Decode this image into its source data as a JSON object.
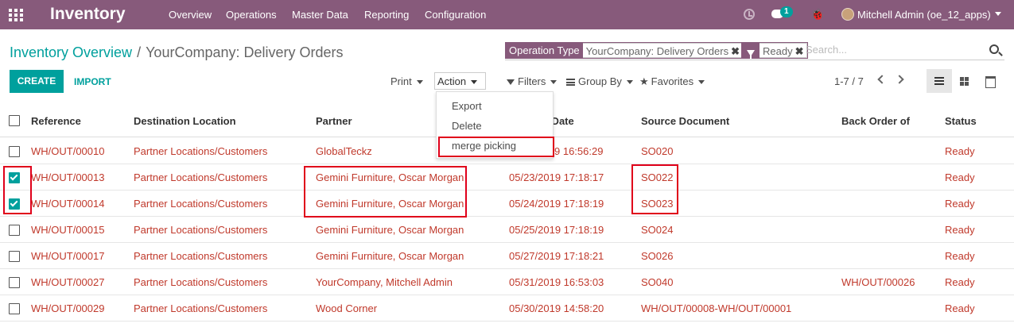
{
  "navbar": {
    "app_title": "Inventory",
    "menu": [
      "Overview",
      "Operations",
      "Master Data",
      "Reporting",
      "Configuration"
    ],
    "chat_count": "1",
    "user_name": "Mitchell Admin (oe_12_apps)"
  },
  "breadcrumb": {
    "parent": "Inventory Overview",
    "separator": "/",
    "current": "YourCompany: Delivery Orders"
  },
  "search": {
    "facets": [
      {
        "label": "Operation Type",
        "value": "YourCompany: Delivery Orders"
      },
      {
        "label": "",
        "value": "Ready"
      }
    ],
    "placeholder": "Search..."
  },
  "buttons": {
    "create": "CREATE",
    "import": "IMPORT",
    "print": "Print",
    "action": "Action",
    "filters": "Filters",
    "group_by": "Group By",
    "favorites": "Favorites"
  },
  "pager": "1-7 / 7",
  "action_menu": [
    "Export",
    "Delete",
    "merge picking"
  ],
  "table": {
    "headers": [
      "Reference",
      "Destination Location",
      "Partner",
      "d Date",
      "Source Document",
      "Back Order of",
      "Status"
    ],
    "rows": [
      {
        "checked": false,
        "ref": "WH/OUT/00010",
        "dest": "Partner Locations/Customers",
        "partner": "GlobalTeckz",
        "date": "05/22/2019 16:56:29",
        "date_visible": "9 16:56:29",
        "source": "SO020",
        "backorder": "",
        "status": "Ready"
      },
      {
        "checked": true,
        "ref": "WH/OUT/00013",
        "dest": "Partner Locations/Customers",
        "partner": "Gemini Furniture, Oscar Morgan",
        "date": "05/23/2019 17:18:17",
        "source": "SO022",
        "backorder": "",
        "status": "Ready"
      },
      {
        "checked": true,
        "ref": "WH/OUT/00014",
        "dest": "Partner Locations/Customers",
        "partner": "Gemini Furniture, Oscar Morgan",
        "date": "05/24/2019 17:18:19",
        "source": "SO023",
        "backorder": "",
        "status": "Ready"
      },
      {
        "checked": false,
        "ref": "WH/OUT/00015",
        "dest": "Partner Locations/Customers",
        "partner": "Gemini Furniture, Oscar Morgan",
        "date": "05/25/2019 17:18:19",
        "source": "SO024",
        "backorder": "",
        "status": "Ready"
      },
      {
        "checked": false,
        "ref": "WH/OUT/00017",
        "dest": "Partner Locations/Customers",
        "partner": "Gemini Furniture, Oscar Morgan",
        "date": "05/27/2019 17:18:21",
        "source": "SO026",
        "backorder": "",
        "status": "Ready"
      },
      {
        "checked": false,
        "ref": "WH/OUT/00027",
        "dest": "Partner Locations/Customers",
        "partner": "YourCompany, Mitchell Admin",
        "date": "05/31/2019 16:53:03",
        "source": "SO040",
        "backorder": "WH/OUT/00026",
        "status": "Ready"
      },
      {
        "checked": false,
        "ref": "WH/OUT/00029",
        "dest": "Partner Locations/Customers",
        "partner": "Wood Corner",
        "date": "05/30/2019 14:58:20",
        "source": "WH/OUT/00008-WH/OUT/00001",
        "backorder": "",
        "status": "Ready"
      }
    ]
  },
  "colors": {
    "brand": "#875a7b",
    "accent": "#00a09d",
    "row_text": "#c0392b",
    "highlight": "#e0001a"
  }
}
